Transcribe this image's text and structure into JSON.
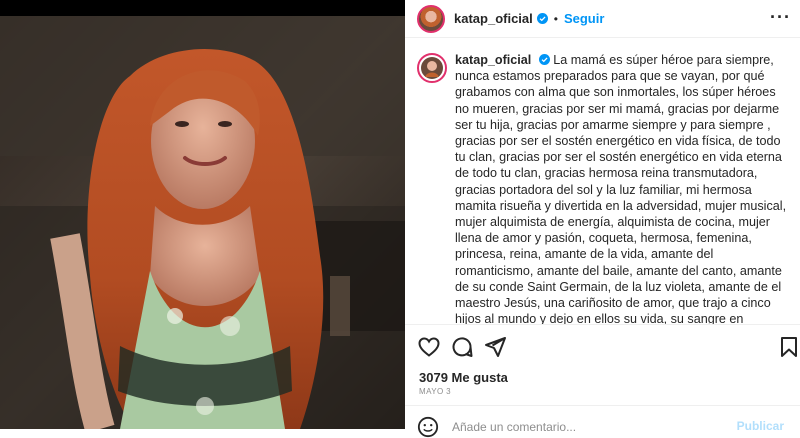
{
  "header": {
    "username": "katap_oficial",
    "separator": "•",
    "follow_label": "Seguir",
    "more_icon": "more-options-icon"
  },
  "caption": {
    "username": "katap_oficial",
    "text": "La mamá es súper héroe para siempre, nunca estamos preparados para que se vayan, por qué grabamos con alma que son inmortales, los súper héroes no mueren, gracias por ser mi mamá, gracias por dejarme ser tu hija, gracias por amarme siempre y para siempre , gracias por ser el sostén energético en vida física, de todo tu clan, gracias por ser el sostén energético en vida eterna de todo tu clan, gracias hermosa reina transmutadora, gracias portadora del sol y la luz familiar, mi hermosa mamita risueña y divertida en la adversidad, mujer musical, mujer alquimista de energía, alquimista de cocina, mujer llena de amor y pasión, coqueta, hermosa, femenina, princesa, reina, amante de la vida, amante del romanticismo, amante del baile, amante del canto, amante de su conde Saint Germain, de la luz violeta, amante de el maestro Jesús, una cariñosito de amor, que trajo a cinco hijos al mundo y dejo en ellos su vida, su sangre en nuestras venas, sue genética vive en mi y en mis hermanos, somos tu sueño de vida , por qué siempre soñaste con ser mamá, utero poderoso, canal de vida eterna,"
  },
  "actions": {
    "like_icon": "heart-icon",
    "comment_icon": "comment-icon",
    "share_icon": "share-icon",
    "save_icon": "bookmark-icon"
  },
  "likes": "3079 Me gusta",
  "date": "MAYO 3",
  "comment_box": {
    "placeholder": "Añade un comentario...",
    "publish_label": "Publicar"
  },
  "colors": {
    "accent": "#0095f6",
    "text": "#262626",
    "muted": "#8e8e8e",
    "publish_disabled": "#b2dffc"
  }
}
